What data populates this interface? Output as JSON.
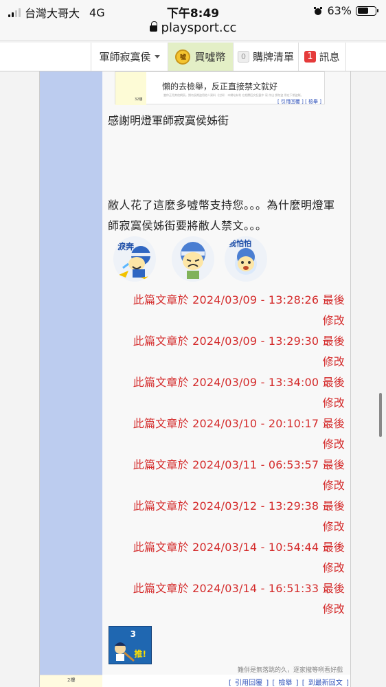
{
  "status_bar": {
    "carrier": "台灣大哥大",
    "network": "4G",
    "time": "下午8:49",
    "battery": "63%",
    "battery_level": 0.63
  },
  "browser": {
    "url": "playsport.cc"
  },
  "nav": {
    "user": "軍師寂寞侯",
    "coin_icon_text": "噓",
    "coin_label": "買噓幣",
    "cart_count": "0",
    "cart_label": "購牌清單",
    "msg_count": "1",
    "msg_label": "訊息"
  },
  "quote": {
    "floor": "32樓",
    "text": "懶的去檢舉，反正直接禁文就好",
    "fine_print": "當你正用其他網頁。請勿長期盜用他人資料（比如） 本網站有利 在相關回文記載中 寫 作出 請勿盜 用在下期盜賊。",
    "links": "[ 引用回覆 ]  [ 檢舉 ]"
  },
  "post": {
    "line1": "感謝明燈軍師寂寞侯姊街",
    "line2": "敝人花了這麼多噓幣支持您。。。為什麼明燈軍師寂寞侯姊街要將敝人禁文。。。"
  },
  "stickers": [
    {
      "icon": "crying-player-sticker",
      "text": "淚奔"
    },
    {
      "icon": "sad-helmet-sticker",
      "text": ""
    },
    {
      "icon": "scared-player-sticker",
      "text": "我怕怕"
    }
  ],
  "edits": [
    {
      "l1": "此篇文章於 2024/03/09 - 13:28:26 最後",
      "l2": "修改"
    },
    {
      "l1": "此篇文章於 2024/03/09 - 13:29:30 最後",
      "l2": "修改"
    },
    {
      "l1": "此篇文章於 2024/03/09 - 13:34:00 最後",
      "l2": "修改"
    },
    {
      "l1": "此篇文章於 2024/03/10 - 20:10:17 最後",
      "l2": "修改"
    },
    {
      "l1": "此篇文章於 2024/03/11 - 06:53:57 最後",
      "l2": "修改"
    },
    {
      "l1": "此篇文章於 2024/03/12 - 13:29:38 最後",
      "l2": "修改"
    },
    {
      "l1": "此篇文章於 2024/03/14 - 10:54:44 最後",
      "l2": "修改"
    },
    {
      "l1": "此篇文章於 2024/03/14 - 16:51:33 最後",
      "l2": "修改"
    }
  ],
  "push": {
    "count": "3",
    "label": "推!"
  },
  "signature": "難併是無落跳的久，逐家攏等咧看好戲",
  "footer": {
    "reply": "[ 引用回覆 ]",
    "report": "[ 檢舉 ]",
    "latest": "[ 到最新回文 ]"
  },
  "next_floor": "2樓"
}
